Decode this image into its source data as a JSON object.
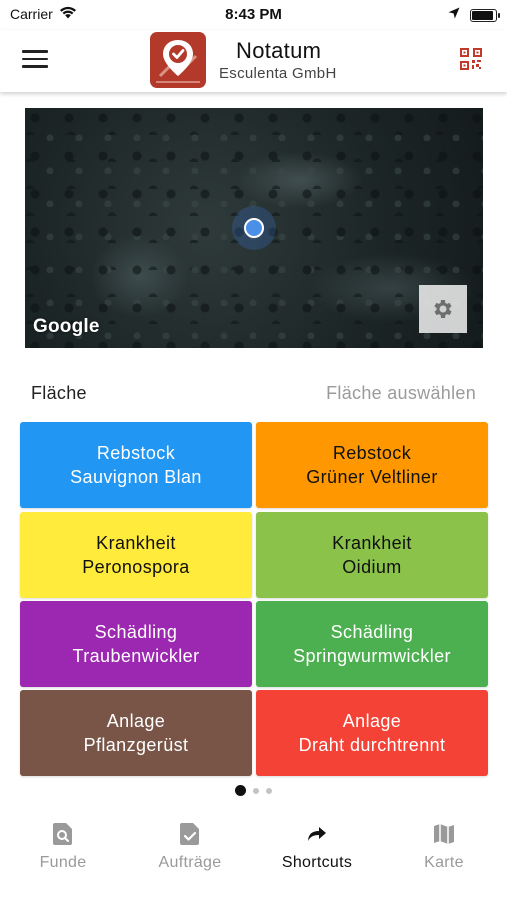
{
  "status_bar": {
    "carrier": "Carrier",
    "time": "8:43 PM",
    "battery_level": 0.9,
    "icons": [
      "wifi-icon",
      "location-arrow-icon",
      "battery-icon"
    ]
  },
  "header": {
    "title": "Notatum",
    "subtitle": "Esculenta GmbH",
    "logo_color": "#b33a2a",
    "icons": [
      "menu-icon",
      "app-logo",
      "qr-code-icon"
    ]
  },
  "map": {
    "attribution": "Google",
    "icons": [
      "location-dot-icon",
      "gear-icon"
    ]
  },
  "area": {
    "label": "Fläche",
    "select_placeholder": "Fläche auswählen"
  },
  "shortcuts": [
    {
      "line1": "Rebstock",
      "line2": "Sauvignon Blan",
      "bg": "#2196f3",
      "fg": "#ffffff"
    },
    {
      "line1": "Rebstock",
      "line2": "Grüner Veltliner",
      "bg": "#ff9800",
      "fg": "#111111"
    },
    {
      "line1": "Krankheit",
      "line2": "Peronospora",
      "bg": "#ffeb3b",
      "fg": "#111111"
    },
    {
      "line1": "Krankheit",
      "line2": "Oidium",
      "bg": "#8bc34a",
      "fg": "#111111"
    },
    {
      "line1": "Schädling",
      "line2": "Traubenwickler",
      "bg": "#9c27b0",
      "fg": "#ffffff"
    },
    {
      "line1": "Schädling",
      "line2": "Springwurmwickler",
      "bg": "#4caf50",
      "fg": "#ffffff"
    },
    {
      "line1": "Anlage",
      "line2": "Pflanzgerüst",
      "bg": "#795548",
      "fg": "#ffffff"
    },
    {
      "line1": "Anlage",
      "line2": "Draht durchtrennt",
      "bg": "#f44336",
      "fg": "#ffffff"
    }
  ],
  "pagination": {
    "pages": 3,
    "active": 0
  },
  "bottom_nav": {
    "active": "shortcuts",
    "items": [
      {
        "id": "funde",
        "label": "Funde",
        "icon": "search-document-icon"
      },
      {
        "id": "auftraege",
        "label": "Aufträge",
        "icon": "checked-document-icon"
      },
      {
        "id": "shortcuts",
        "label": "Shortcuts",
        "icon": "share-arrow-icon"
      },
      {
        "id": "karte",
        "label": "Karte",
        "icon": "map-icon"
      }
    ]
  }
}
